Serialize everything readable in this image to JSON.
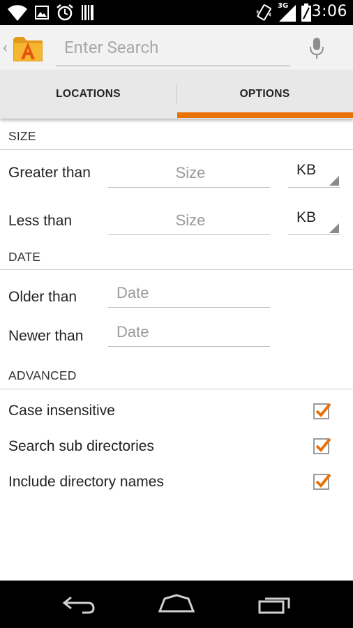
{
  "status_bar": {
    "time": "3:06",
    "network_label": "3G",
    "icons": [
      "wifi-icon",
      "image-icon",
      "alarm-icon",
      "barcode-icon",
      "vibrate-icon",
      "signal-icon",
      "battery-icon"
    ]
  },
  "action_bar": {
    "back_glyph": "‹",
    "search_placeholder": "Enter Search",
    "search_value": ""
  },
  "tabs": {
    "locations_label": "LOCATIONS",
    "options_label": "OPTIONS",
    "active": "OPTIONS"
  },
  "size": {
    "header": "SIZE",
    "greater_label": "Greater than",
    "greater_placeholder": "Size",
    "greater_unit": "KB",
    "less_label": "Less than",
    "less_placeholder": "Size",
    "less_unit": "KB"
  },
  "date": {
    "header": "DATE",
    "older_label": "Older than",
    "older_placeholder": "Date",
    "newer_label": "Newer than",
    "newer_placeholder": "Date"
  },
  "advanced": {
    "header": "ADVANCED",
    "items": [
      {
        "label": "Case insensitive",
        "checked": true
      },
      {
        "label": "Search sub directories",
        "checked": true
      },
      {
        "label": "Include directory names",
        "checked": true
      }
    ]
  },
  "colors": {
    "accent": "#e8710a",
    "status_bar": "#000000",
    "tab_background": "#e8e8e8"
  }
}
